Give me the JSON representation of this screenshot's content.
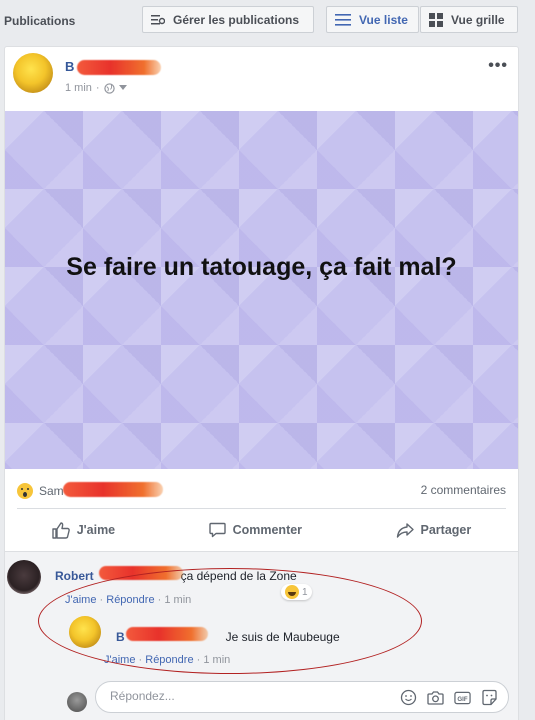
{
  "header": {
    "title": "Publications",
    "manage_label": "Gérer les publications",
    "list_view_label": "Vue liste",
    "grid_view_label": "Vue grille"
  },
  "post": {
    "author_initial": "B",
    "time": "1 min",
    "text": "Se faire un tatouage, ça fait mal?",
    "reaction_name_prefix": "Sam",
    "comment_count": "2 commentaires",
    "actions": {
      "like": "J'aime",
      "comment": "Commenter",
      "share": "Partager"
    }
  },
  "comments": [
    {
      "author": "Robert",
      "text": "ça dépend de la Zone",
      "like_link": "J'aime",
      "reply_link": "Répondre",
      "time": "1 min",
      "reaction_count": "1"
    }
  ],
  "reply": {
    "author_initial": "B",
    "text": "Je suis de Maubeuge",
    "like_link": "J'aime",
    "reply_link": "Répondre",
    "time": "1 min"
  },
  "reply_box": {
    "placeholder": "Répondez..."
  },
  "colors": {
    "accent": "#4267b2",
    "name_link": "#365899",
    "post_background": "#c6c2ef",
    "annotation_circle": "#b22222"
  }
}
